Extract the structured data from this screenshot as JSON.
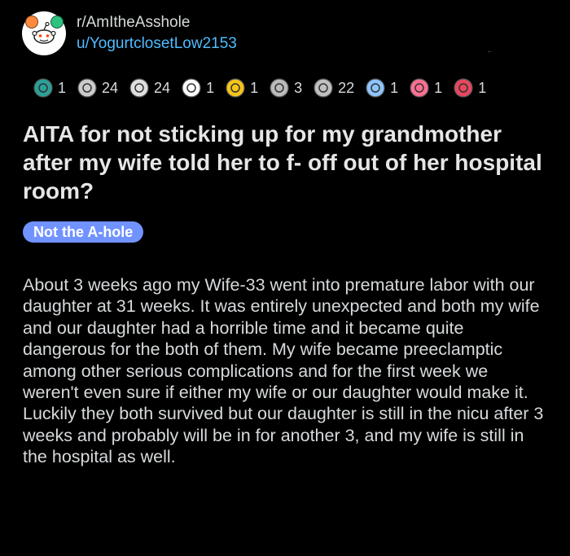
{
  "header": {
    "subreddit": "r/AmItheAsshole",
    "username": "u/YogurtclosetLow2153"
  },
  "awards": [
    {
      "icon": "helpful-award-icon",
      "count": "1",
      "color": "#2aa198"
    },
    {
      "icon": "hug-award-icon",
      "count": "24",
      "color": "#cccccc"
    },
    {
      "icon": "wholesome-award-icon",
      "count": "24",
      "color": "#e0e0e0"
    },
    {
      "icon": "snoo-award-icon",
      "count": "1",
      "color": "#ffffff"
    },
    {
      "icon": "glow-award-icon",
      "count": "1",
      "color": "#f5c518"
    },
    {
      "icon": "take-my-energy-award-icon",
      "count": "3",
      "color": "#bbbbbb"
    },
    {
      "icon": "silver-award-icon",
      "count": "22",
      "color": "#c0c0c0"
    },
    {
      "icon": "angel-award-icon",
      "count": "1",
      "color": "#8ec5ff"
    },
    {
      "icon": "heart-eyes-award-icon",
      "count": "1",
      "color": "#ff6f91"
    },
    {
      "icon": "broken-heart-award-icon",
      "count": "1",
      "color": "#e8475f"
    }
  ],
  "post": {
    "title": "AITA for not sticking up for my grandmother after my wife told her to f- off out of her hospital room?",
    "flair": "Not the A-hole",
    "body": "About 3 weeks ago my Wife-33 went into premature labor with our daughter at 31 weeks. It was entirely unexpected and both my wife and our daughter had a horrible time and it became quite dangerous for the both of them. My wife became preeclamptic among other serious complications and for the first week we weren't even sure if either my wife or our daughter would make it. Luckily they both survived but our daughter is still in the nicu after 3 weeks and probably will be in for another 3, and my wife is still in the hospital as well."
  },
  "colors": {
    "background": "#000000",
    "text": "#d7dadc",
    "username": "#4fbcff",
    "flair": "#7193ff"
  }
}
